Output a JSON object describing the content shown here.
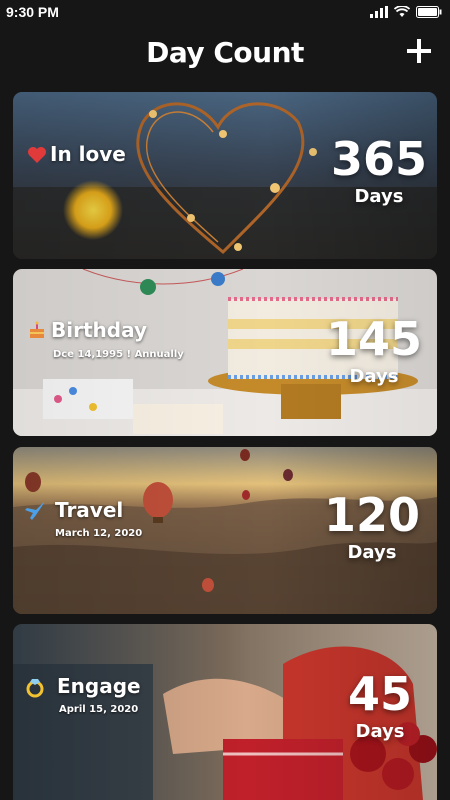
{
  "status_bar": {
    "time": "9:30 PM"
  },
  "header": {
    "title": "Day Count",
    "add_icon": "plus-icon"
  },
  "cards": [
    {
      "icon": "heart-icon",
      "title": "In love",
      "date": "",
      "count": "365",
      "unit": "Days"
    },
    {
      "icon": "cake-icon",
      "title": "Birthday",
      "date": "Dce 14,1995 ! Annually",
      "count": "145",
      "unit": "Days"
    },
    {
      "icon": "airplane-icon",
      "title": "Travel",
      "date": "March 12, 2020",
      "count": "120",
      "unit": "Days"
    },
    {
      "icon": "ring-icon",
      "title": "Engage",
      "date": "April 15, 2020",
      "count": "45",
      "unit": "Days"
    }
  ]
}
